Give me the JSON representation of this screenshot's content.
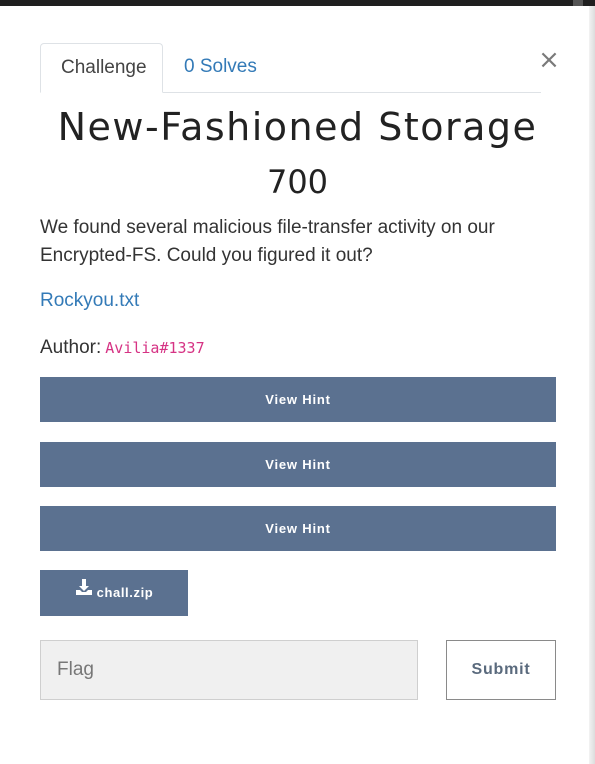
{
  "modal": {
    "close_label": "×"
  },
  "tabs": [
    {
      "label": "Challenge",
      "active": true
    },
    {
      "label": "0 Solves",
      "active": false
    }
  ],
  "challenge": {
    "name": "New-Fashioned Storage",
    "points": "700",
    "description": "We found several malicious file-transfer activity on our Encrypted-FS. Could you figured it out?",
    "link_text": "Rockyou.txt",
    "author_label": "Author:",
    "author_handle": "Avilia#1337"
  },
  "hints": [
    {
      "label": "View Hint"
    },
    {
      "label": "View Hint"
    },
    {
      "label": "View Hint"
    }
  ],
  "files": [
    {
      "label": "chall.zip",
      "icon": "download-icon"
    }
  ],
  "flag_form": {
    "placeholder": "Flag",
    "value": "",
    "submit_label": "Submit"
  },
  "colors": {
    "primary_button": "#5b7190",
    "link": "#337ab7",
    "author_handle": "#d63384"
  }
}
